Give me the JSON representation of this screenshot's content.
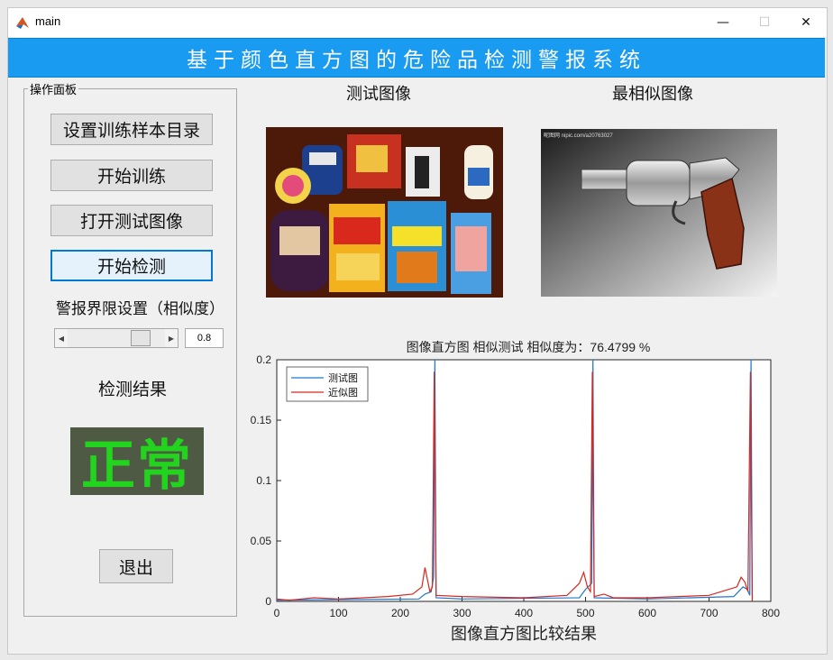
{
  "window": {
    "title": "main",
    "minimize": "—",
    "maximize": "☐",
    "close": "✕"
  },
  "banner": {
    "title": "基于颜色直方图的危险品检测警报系统"
  },
  "panel": {
    "title": "操作面板",
    "buttons": {
      "set_dir": "设置训练样本目录",
      "train": "开始训练",
      "open_test": "打开测试图像",
      "detect": "开始检测",
      "exit": "退出"
    },
    "threshold_label": "警报界限设置（相似度）",
    "threshold_value": "0.8",
    "threshold_fraction": 0.8,
    "result_label": "检测结果",
    "result_value": "正常"
  },
  "images": {
    "test_title": "测试图像",
    "similar_title": "最相似图像",
    "similar_watermark": "昵图网 nipic.com/a20763027"
  },
  "chart_data": {
    "type": "line",
    "title": "图像直方图 相似测试 相似度为：76.4799 %",
    "xlabel": "图像直方图比较结果",
    "ylabel": "",
    "xlim": [
      0,
      800
    ],
    "ylim": [
      0,
      0.2
    ],
    "xticks": [
      "0",
      "100",
      "200",
      "300",
      "400",
      "500",
      "600",
      "700",
      "800"
    ],
    "yticks": [
      "0",
      "0.05",
      "0.1",
      "0.15",
      "0.2"
    ],
    "legend_position": "top-left",
    "series": [
      {
        "name": "测试图",
        "color": "#1f77d0",
        "points": [
          [
            0,
            0.001
          ],
          [
            230,
            0.002
          ],
          [
            240,
            0.006
          ],
          [
            250,
            0.008
          ],
          [
            254,
            0.02
          ],
          [
            256,
            0.2
          ],
          [
            258,
            0.003
          ],
          [
            300,
            0.002
          ],
          [
            490,
            0.003
          ],
          [
            500,
            0.01
          ],
          [
            510,
            0.015
          ],
          [
            512,
            0.2
          ],
          [
            514,
            0.003
          ],
          [
            600,
            0.002
          ],
          [
            740,
            0.004
          ],
          [
            755,
            0.012
          ],
          [
            762,
            0.01
          ],
          [
            766,
            0.005
          ],
          [
            768,
            0.2
          ],
          [
            770,
            0
          ]
        ]
      },
      {
        "name": "近似图",
        "color": "#d6281e",
        "points": [
          [
            0,
            0.002
          ],
          [
            20,
            0.001
          ],
          [
            60,
            0.003
          ],
          [
            100,
            0.002
          ],
          [
            180,
            0.004
          ],
          [
            220,
            0.006
          ],
          [
            235,
            0.012
          ],
          [
            240,
            0.028
          ],
          [
            244,
            0.018
          ],
          [
            248,
            0.008
          ],
          [
            252,
            0.012
          ],
          [
            255,
            0.19
          ],
          [
            258,
            0.005
          ],
          [
            300,
            0.004
          ],
          [
            400,
            0.003
          ],
          [
            470,
            0.005
          ],
          [
            490,
            0.015
          ],
          [
            497,
            0.024
          ],
          [
            503,
            0.012
          ],
          [
            508,
            0.008
          ],
          [
            511,
            0.19
          ],
          [
            514,
            0.004
          ],
          [
            530,
            0.006
          ],
          [
            545,
            0.003
          ],
          [
            600,
            0.003
          ],
          [
            700,
            0.005
          ],
          [
            745,
            0.012
          ],
          [
            752,
            0.02
          ],
          [
            758,
            0.016
          ],
          [
            763,
            0.008
          ],
          [
            767,
            0.19
          ],
          [
            770,
            0
          ]
        ]
      }
    ]
  }
}
